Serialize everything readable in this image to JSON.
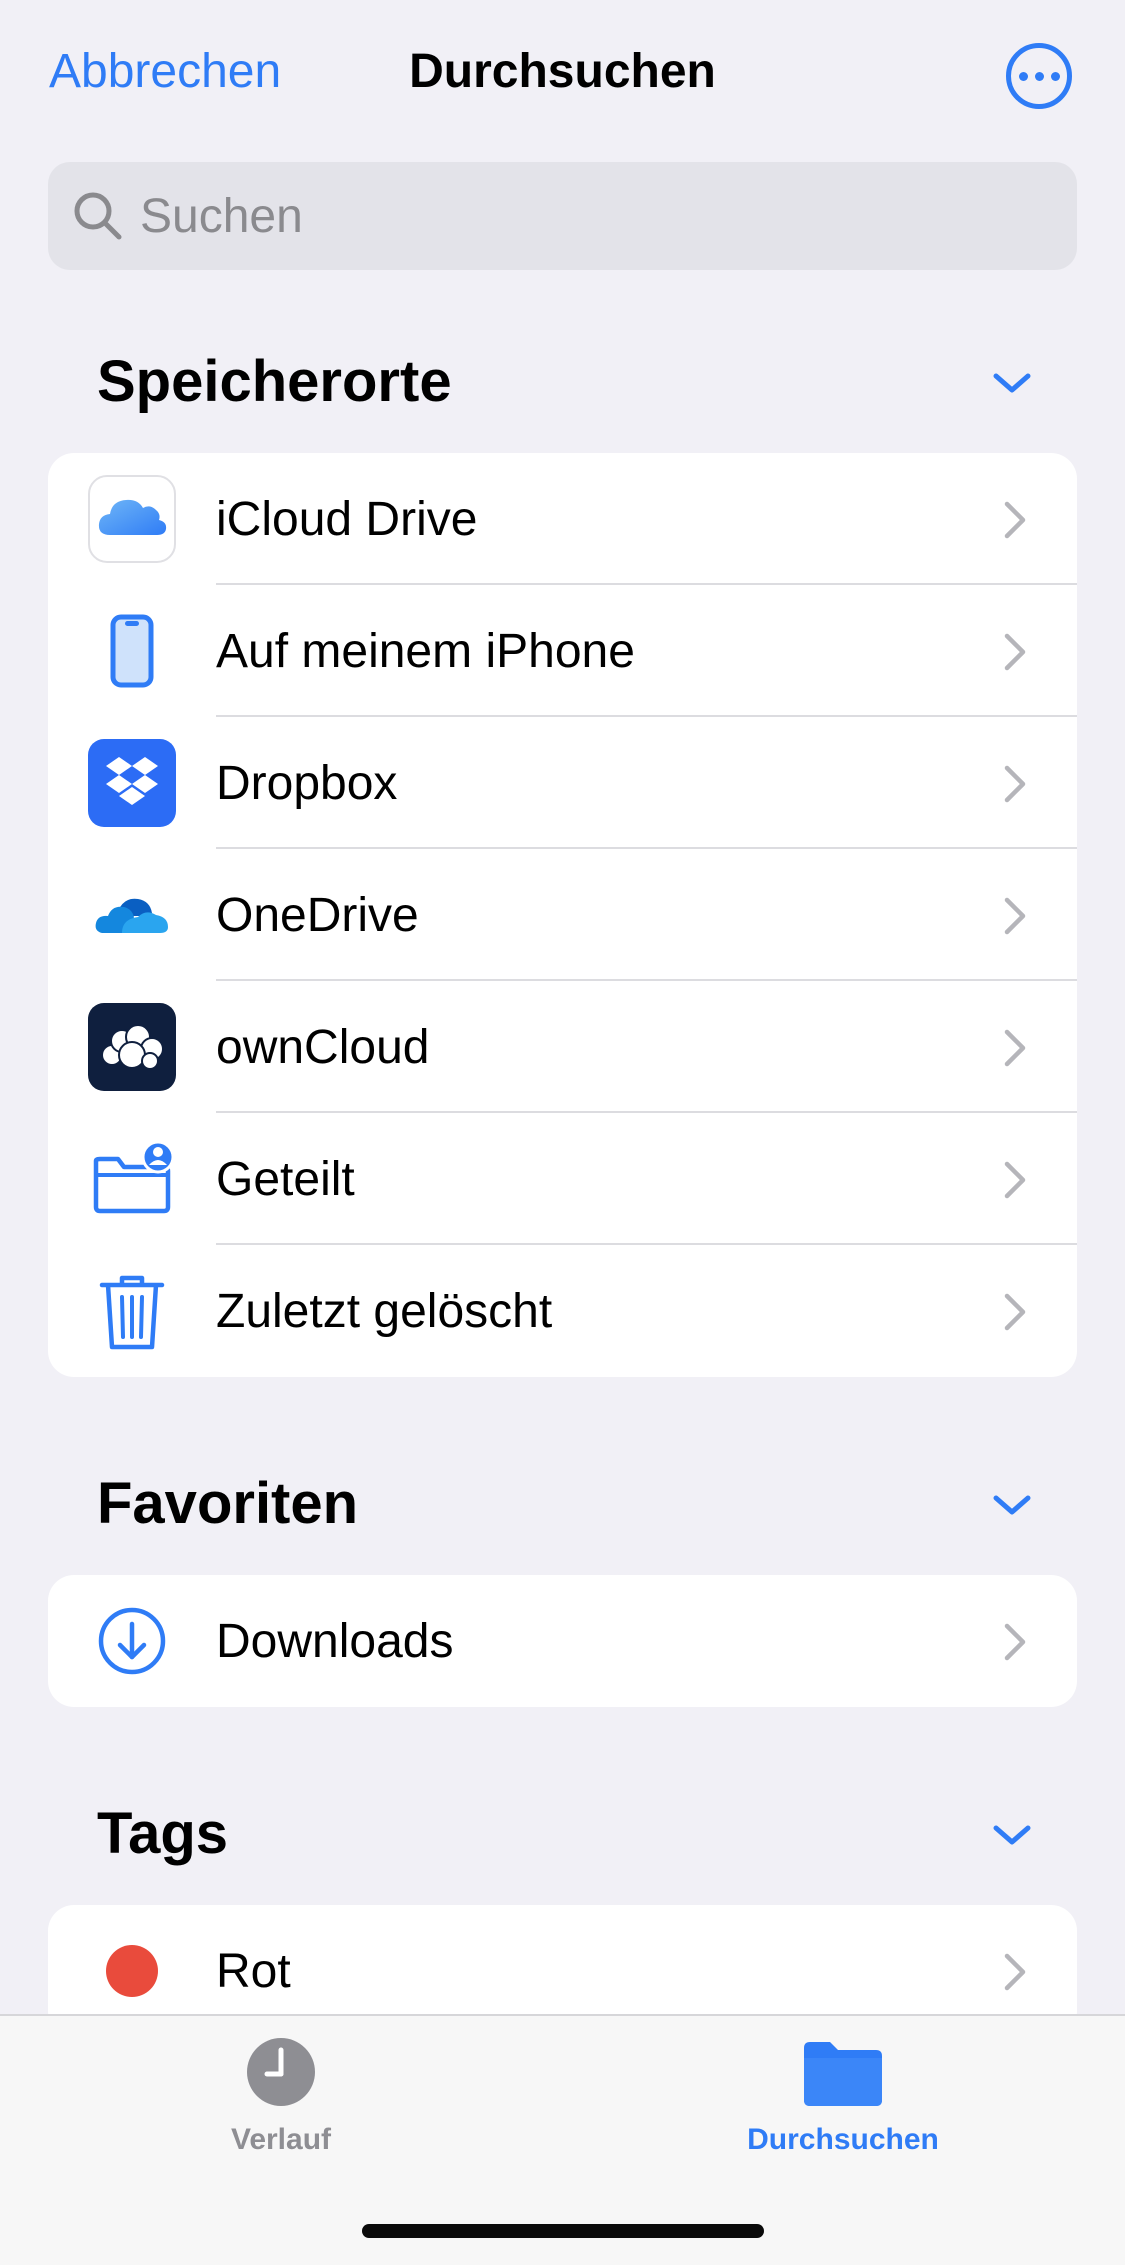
{
  "nav": {
    "cancel_label": "Abbrechen",
    "title": "Durchsuchen",
    "more_icon": "ellipsis-circle-icon"
  },
  "search": {
    "placeholder": "Suchen",
    "icon": "search-icon"
  },
  "sections": {
    "locations": {
      "title": "Speicherorte",
      "items": [
        {
          "label": "iCloud Drive",
          "icon": "icloud-icon"
        },
        {
          "label": "Auf meinem iPhone",
          "icon": "iphone-icon"
        },
        {
          "label": "Dropbox",
          "icon": "dropbox-icon"
        },
        {
          "label": "OneDrive",
          "icon": "onedrive-icon"
        },
        {
          "label": "ownCloud",
          "icon": "owncloud-icon"
        },
        {
          "label": "Geteilt",
          "icon": "shared-folder-icon"
        },
        {
          "label": "Zuletzt gelöscht",
          "icon": "trash-icon"
        }
      ]
    },
    "favorites": {
      "title": "Favoriten",
      "items": [
        {
          "label": "Downloads",
          "icon": "download-circle-icon"
        }
      ]
    },
    "tags": {
      "title": "Tags",
      "items": [
        {
          "label": "Rot",
          "icon": "red-tag-dot-icon",
          "color": "#e94b3c"
        }
      ]
    }
  },
  "tabbar": {
    "tabs": [
      {
        "label": "Verlauf",
        "icon": "clock-icon",
        "active": false
      },
      {
        "label": "Durchsuchen",
        "icon": "folder-icon",
        "active": true
      }
    ]
  },
  "colors": {
    "accent": "#2f7cf6",
    "background": "#f1f0f6",
    "inactive_tab": "#8e8e93"
  }
}
